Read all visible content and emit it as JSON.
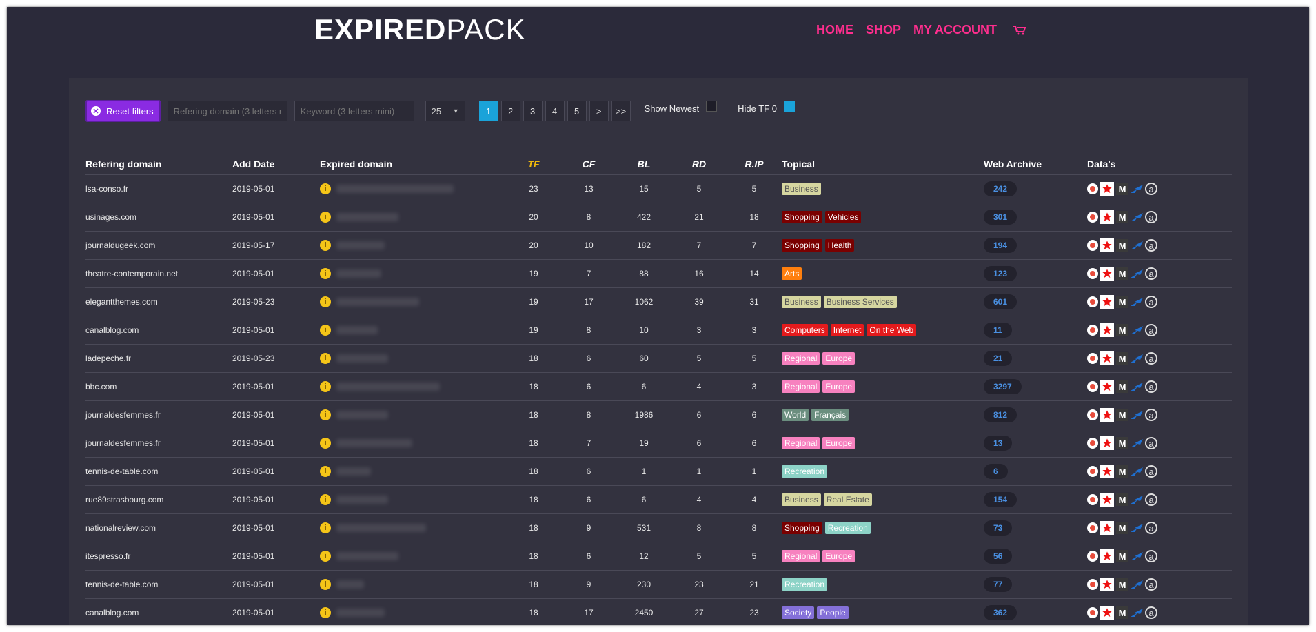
{
  "header": {
    "logo_bold": "EXPIRED",
    "logo_light": "PACK",
    "nav": [
      "HOME",
      "SHOP",
      "MY ACCOUNT"
    ]
  },
  "filters": {
    "reset_label": "Reset filters",
    "referring_placeholder": "Refering domain (3 letters mini)",
    "keyword_placeholder": "Keyword (3 letters mini)",
    "per_page": "25",
    "pages": [
      "1",
      "2",
      "3",
      "4",
      "5",
      ">",
      ">>"
    ],
    "active_page": "1",
    "show_newest": "Show Newest",
    "hide_tf0": "Hide TF 0"
  },
  "columns": [
    "Refering domain",
    "Add Date",
    "Expired domain",
    "TF",
    "CF",
    "BL",
    "RD",
    "R.IP",
    "Topical",
    "Web Archive",
    "Data's"
  ],
  "colors": {
    "Business": [
      "#d6d6a0",
      "#555"
    ],
    "Business Services": [
      "#d6d6a0",
      "#555"
    ],
    "Real Estate": [
      "#d6d6a0",
      "#555"
    ],
    "Shopping": [
      "#7a0000",
      "#fff"
    ],
    "Vehicles": [
      "#7a0000",
      "#fff"
    ],
    "Health": [
      "#7a0000",
      "#fff"
    ],
    "Recreation": [
      "#8dd3c7",
      "#fff"
    ],
    "Arts": [
      "#ff7f0e",
      "#fff"
    ],
    "Computers": [
      "#e41a1c",
      "#fff"
    ],
    "Internet": [
      "#e41a1c",
      "#fff"
    ],
    "On the Web": [
      "#e41a1c",
      "#fff"
    ],
    "Regional": [
      "#f781bf",
      "#fff"
    ],
    "Europe": [
      "#f781bf",
      "#fff"
    ],
    "World": [
      "#6b8e7f",
      "#fff"
    ],
    "Français": [
      "#6b8e7f",
      "#fff"
    ],
    "Society": [
      "#8470d8",
      "#fff"
    ],
    "People": [
      "#8470d8",
      "#fff"
    ]
  },
  "rows": [
    {
      "ref": "lsa-conso.fr",
      "date": "2019-05-01",
      "tf": "23",
      "cf": "13",
      "bl": "15",
      "rd": "5",
      "rip": "5",
      "topics": [
        "Business"
      ],
      "wa": "242"
    },
    {
      "ref": "usinages.com",
      "date": "2019-05-01",
      "tf": "20",
      "cf": "8",
      "bl": "422",
      "rd": "21",
      "rip": "18",
      "topics": [
        "Shopping",
        "Vehicles"
      ],
      "wa": "301"
    },
    {
      "ref": "journaldugeek.com",
      "date": "2019-05-17",
      "tf": "20",
      "cf": "10",
      "bl": "182",
      "rd": "7",
      "rip": "7",
      "topics": [
        "Shopping",
        "Health"
      ],
      "wa": "194"
    },
    {
      "ref": "theatre-contemporain.net",
      "date": "2019-05-01",
      "tf": "19",
      "cf": "7",
      "bl": "88",
      "rd": "16",
      "rip": "14",
      "topics": [
        "Arts"
      ],
      "wa": "123"
    },
    {
      "ref": "elegantthemes.com",
      "date": "2019-05-23",
      "tf": "19",
      "cf": "17",
      "bl": "1062",
      "rd": "39",
      "rip": "31",
      "topics": [
        "Business",
        "Business Services"
      ],
      "wa": "601"
    },
    {
      "ref": "canalblog.com",
      "date": "2019-05-01",
      "tf": "19",
      "cf": "8",
      "bl": "10",
      "rd": "3",
      "rip": "3",
      "topics": [
        "Computers",
        "Internet",
        "On the Web"
      ],
      "wa": "11"
    },
    {
      "ref": "ladepeche.fr",
      "date": "2019-05-23",
      "tf": "18",
      "cf": "6",
      "bl": "60",
      "rd": "5",
      "rip": "5",
      "topics": [
        "Regional",
        "Europe"
      ],
      "wa": "21"
    },
    {
      "ref": "bbc.com",
      "date": "2019-05-01",
      "tf": "18",
      "cf": "6",
      "bl": "6",
      "rd": "4",
      "rip": "3",
      "topics": [
        "Regional",
        "Europe"
      ],
      "wa": "3297"
    },
    {
      "ref": "journaldesfemmes.fr",
      "date": "2019-05-01",
      "tf": "18",
      "cf": "8",
      "bl": "1986",
      "rd": "6",
      "rip": "6",
      "topics": [
        "World",
        "Français"
      ],
      "wa": "812"
    },
    {
      "ref": "journaldesfemmes.fr",
      "date": "2019-05-01",
      "tf": "18",
      "cf": "7",
      "bl": "19",
      "rd": "6",
      "rip": "6",
      "topics": [
        "Regional",
        "Europe"
      ],
      "wa": "13"
    },
    {
      "ref": "tennis-de-table.com",
      "date": "2019-05-01",
      "tf": "18",
      "cf": "6",
      "bl": "1",
      "rd": "1",
      "rip": "1",
      "topics": [
        "Recreation"
      ],
      "wa": "6"
    },
    {
      "ref": "rue89strasbourg.com",
      "date": "2019-05-01",
      "tf": "18",
      "cf": "6",
      "bl": "6",
      "rd": "4",
      "rip": "4",
      "topics": [
        "Business",
        "Real Estate"
      ],
      "wa": "154"
    },
    {
      "ref": "nationalreview.com",
      "date": "2019-05-01",
      "tf": "18",
      "cf": "9",
      "bl": "531",
      "rd": "8",
      "rip": "8",
      "topics": [
        "Shopping",
        "Recreation"
      ],
      "wa": "73"
    },
    {
      "ref": "itespresso.fr",
      "date": "2019-05-01",
      "tf": "18",
      "cf": "6",
      "bl": "12",
      "rd": "5",
      "rip": "5",
      "topics": [
        "Regional",
        "Europe"
      ],
      "wa": "56"
    },
    {
      "ref": "tennis-de-table.com",
      "date": "2019-05-01",
      "tf": "18",
      "cf": "9",
      "bl": "230",
      "rd": "23",
      "rip": "21",
      "topics": [
        "Recreation"
      ],
      "wa": "77"
    },
    {
      "ref": "canalblog.com",
      "date": "2019-05-01",
      "tf": "18",
      "cf": "17",
      "bl": "2450",
      "rd": "27",
      "rip": "23",
      "topics": [
        "Society",
        "People"
      ],
      "wa": "362"
    }
  ]
}
